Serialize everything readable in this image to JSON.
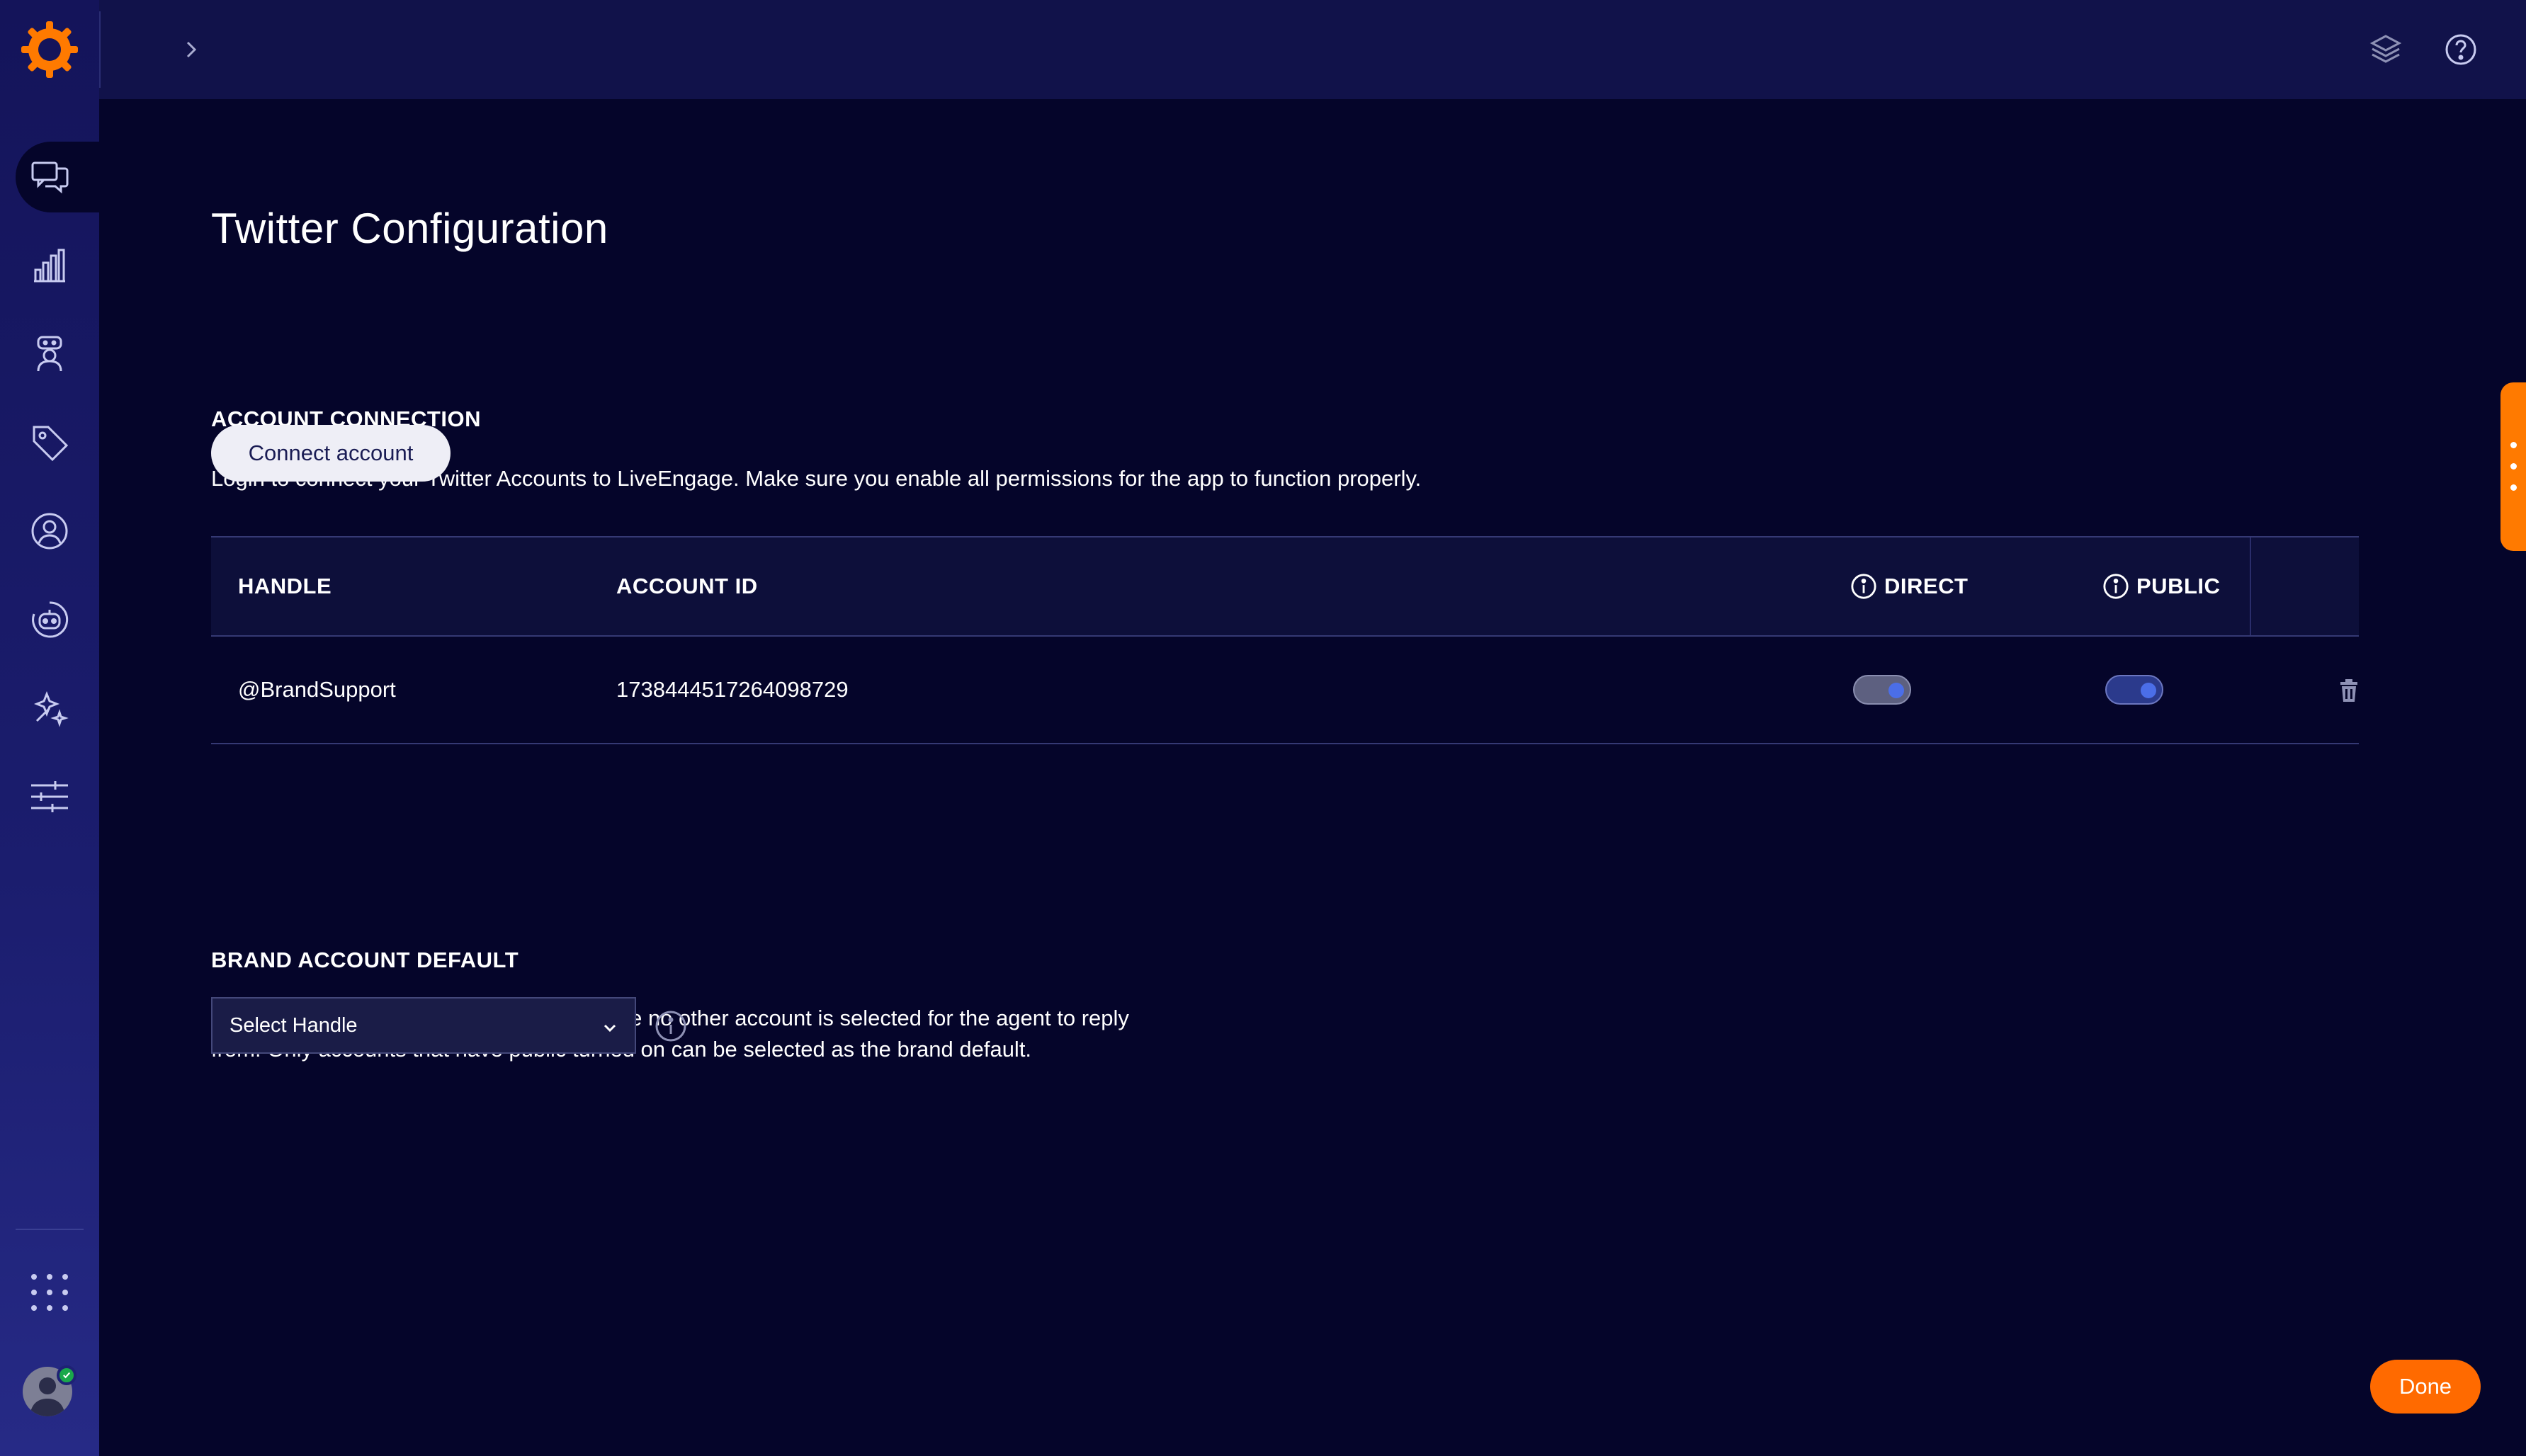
{
  "colors": {
    "background": "#05052a",
    "sidebar": "#1b1d6e",
    "header": "#11124a",
    "accent": "#ff6a00",
    "toggle_knob": "#4b6ee8",
    "status_online": "#1aa84b"
  },
  "sidebar": {
    "logo": "liveperson-logo",
    "items": [
      {
        "icon": "conversations-icon",
        "active": true
      },
      {
        "icon": "analytics-icon",
        "active": false
      },
      {
        "icon": "agent-icon",
        "active": false
      },
      {
        "icon": "tag-icon",
        "active": false
      },
      {
        "icon": "user-profile-icon",
        "active": false
      },
      {
        "icon": "bot-icon",
        "active": false
      },
      {
        "icon": "automation-icon",
        "active": false
      },
      {
        "icon": "settings-sliders-icon",
        "active": false
      }
    ],
    "apps_icon": "apps-grid-icon",
    "avatar_icon": "user-avatar-icon",
    "status": "online"
  },
  "header": {
    "expand_icon": "chevron-right-icon",
    "layers_icon": "layers-icon",
    "help_icon": "help-icon"
  },
  "page": {
    "title": "Twitter Configuration",
    "account_connection": {
      "heading": "ACCOUNT CONNECTION",
      "description": "Login to connect your Twitter Accounts to LiveEngage. Make sure you enable all permissions for the app to function properly.",
      "connect_button": "Connect account"
    },
    "table": {
      "headers": {
        "handle": "HANDLE",
        "account_id": "ACCOUNT ID",
        "direct": "DIRECT",
        "public": "PUBLIC"
      },
      "rows": [
        {
          "handle": "@BrandSupport",
          "account_id": "1738444517264098729",
          "direct": true,
          "public": true
        }
      ]
    },
    "brand_default": {
      "heading": "BRAND ACCOUNT DEFAULT",
      "description_line1": "Pick an account as the brand default in case no other account is selected for the agent to reply",
      "description_line2": "from. Only accounts that have public turned on can be selected as the brand default.",
      "select_value": "Select Handle"
    },
    "done_button": "Done"
  }
}
